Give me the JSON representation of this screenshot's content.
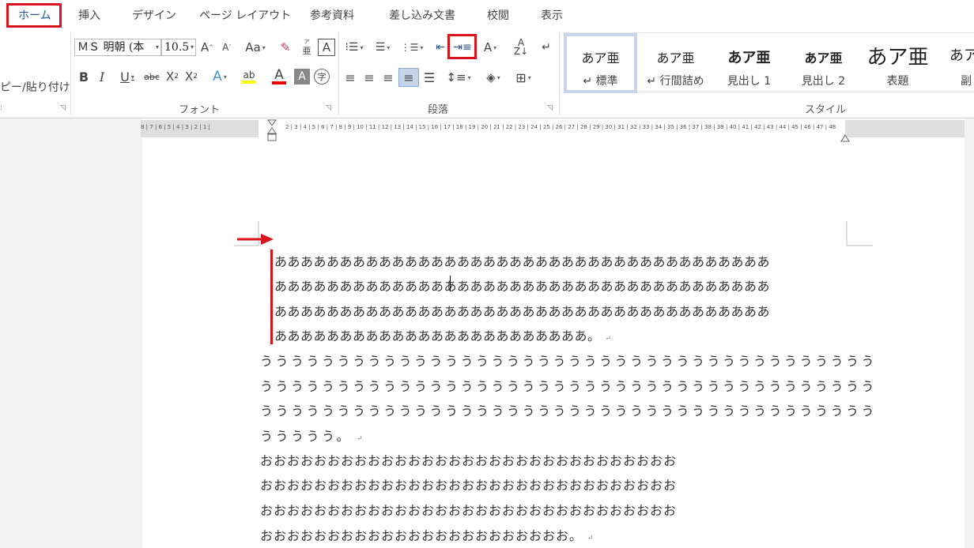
{
  "tabs": [
    "ホーム",
    "挿入",
    "デザイン",
    "ページ レイアウト",
    "参考資料",
    "差し込み文書",
    "校閲",
    "表示"
  ],
  "clipboard": {
    "paste_label": "ピー/貼り付け"
  },
  "font": {
    "name": "ＭＳ 明朝 (本",
    "size": "10.5",
    "group_label": "フォント"
  },
  "paragraph": {
    "group_label": "段落"
  },
  "styles": {
    "group_label": "スタイル",
    "items": [
      {
        "preview": "あア亜",
        "name": "↵ 標準"
      },
      {
        "preview": "あア亜",
        "name": "↵ 行間詰め"
      },
      {
        "preview": "あア亜",
        "name": "見出し 1"
      },
      {
        "preview": "あア亜",
        "name": "見出し 2"
      },
      {
        "preview": "あア亜",
        "name": "表題"
      },
      {
        "preview": "あア",
        "name": "副"
      }
    ]
  },
  "ruler": {
    "left_numbers": "8 | 7 | 6 | 5 | 4 | 3 | 2 | 1 |",
    "right_numbers": "2 | 3 | 4 | 5 | 6 | 7 | 8 | 9 | 10 | 11 | 12 | 13 | 14 | 15 | 16 | 17 | 18 | 19 | 20 | 21 | 22 | 23 | 24 | 25 | 26 | 27 | 28 | 29 | 30 | 31 | 32 | 33 | 34 | 35 | 36 | 37 | 38 | 39 | 40 | 41 | 42 | 43 | 44 | 45 | 46 | 47 | 48"
  },
  "document": {
    "para1": [
      "ああああああああああああああああああああああああああああああああああああああ",
      "ああああああああああああああああああああああああああああああああああああああ",
      "ああああああああああああああああああああああああああああああああああああああ",
      "ああああああああああああああああああああああああ。"
    ],
    "para2": [
      "うううううううううううううううううううううううううううううううううううううううう",
      "うううううううううううううううううううううううううううううううううううううううう",
      "うううううううううううううううううううううううううううううううううううううううう",
      "ううううう。"
    ],
    "para3": [
      "おおおおおおおおおおおおおおおおおおおおおおおおおおおおおおお",
      "おおおおおおおおおおおおおおおおおおおおおおおおおおおおおおお",
      "おおおおおおおおおおおおおおおおおおおおおおおおおおおおおおお",
      "おおおおおおおおおおおおおおおおおおおおおおお。"
    ],
    "para_mark": "↵"
  },
  "colors": {
    "accent": "#2b579a",
    "highlight_red": "#d9121b"
  }
}
